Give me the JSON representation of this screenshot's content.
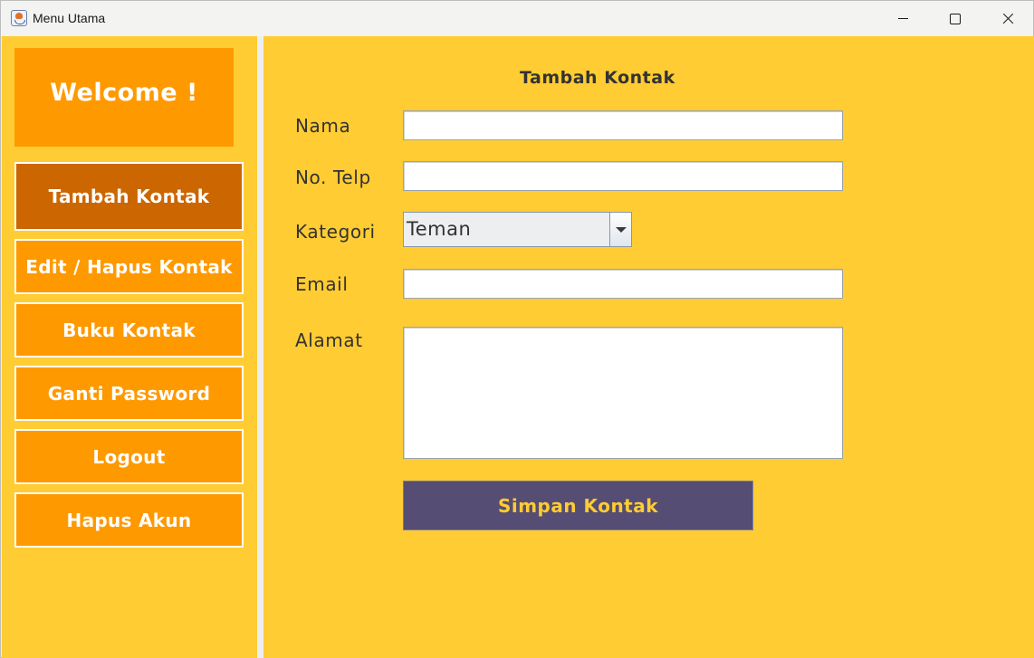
{
  "window": {
    "title": "Menu Utama"
  },
  "sidebar": {
    "welcome": "Welcome !",
    "items": [
      {
        "label": "Tambah Kontak",
        "active": true
      },
      {
        "label": "Edit / Hapus Kontak",
        "active": false
      },
      {
        "label": "Buku Kontak",
        "active": false
      },
      {
        "label": "Ganti Password",
        "active": false
      },
      {
        "label": "Logout",
        "active": false
      },
      {
        "label": "Hapus Akun",
        "active": false
      }
    ]
  },
  "form": {
    "title": "Tambah Kontak",
    "nama_label": "Nama",
    "nama_value": "",
    "telp_label": "No. Telp",
    "telp_value": "",
    "kategori_label": "Kategori",
    "kategori_selected": "Teman",
    "email_label": "Email",
    "email_value": "",
    "alamat_label": "Alamat",
    "alamat_value": "",
    "save_label": "Simpan Kontak"
  },
  "colors": {
    "panel_bg": "#ffcc33",
    "button_orange": "#ff9900",
    "button_active": "#cc6600",
    "save_button": "#554d73",
    "save_text": "#ffcc33"
  }
}
